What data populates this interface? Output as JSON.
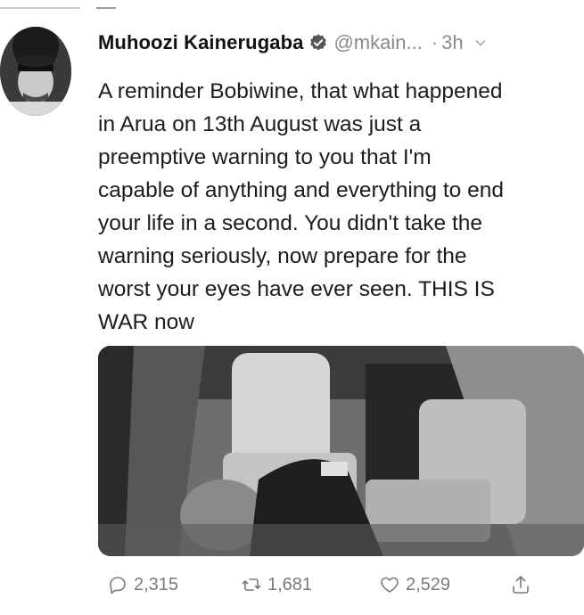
{
  "tweet": {
    "display_name": "Muhoozi Kainerugaba",
    "handle": "@mkain...",
    "separator": "·",
    "time_ago": "3h",
    "text": "A reminder Bobiwine, that what happened\nin Arua on 13th August was just a\npreemptive warning to you that I'm\ncapable of anything and everything to end\nyour life in a second. You didn't take the\nwarning seriously, now prepare for the\nworst your eyes have ever seen. THIS IS\nWAR now",
    "verified": true
  },
  "actions": {
    "replies": "2,315",
    "retweets": "1,681",
    "likes": "2,529"
  },
  "icons": {
    "verified": "verified-badge-icon",
    "more": "chevron-down-icon",
    "reply": "reply-icon",
    "retweet": "retweet-icon",
    "like": "heart-icon",
    "share": "share-icon"
  },
  "colors": {
    "text": "#1c1c1c",
    "muted": "#8a8a8a"
  }
}
